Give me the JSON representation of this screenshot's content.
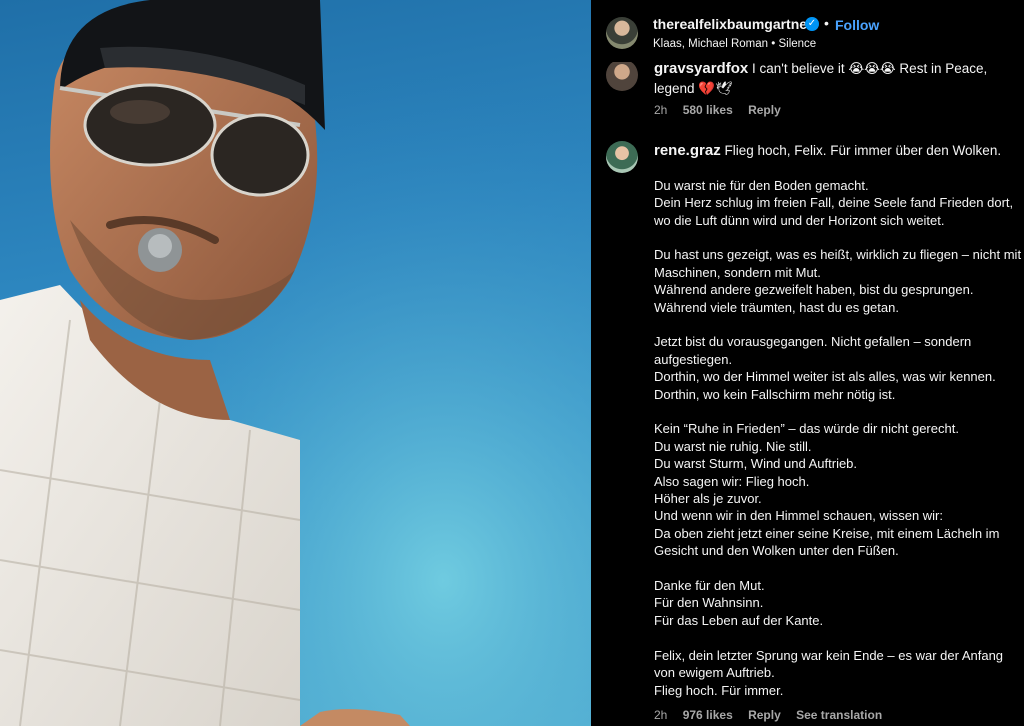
{
  "post": {
    "username": "therealfelixbaumgartner",
    "verified_icon": "verified-badge-icon",
    "separator": "•",
    "follow_label": "Follow",
    "audio": "Klaas, Michael Roman • Silence"
  },
  "comments": [
    {
      "username": "gravsyardfox",
      "text": "I can't believe it 😭😭😭 Rest in Peace, legend 💔🕊",
      "time": "2h",
      "likes": "580 likes",
      "reply": "Reply"
    },
    {
      "username": "rene.graz",
      "first_line": "Flieg hoch, Felix. Für immer über den Wolken.",
      "lines": [
        "",
        "Du warst nie für den Boden gemacht.",
        "Dein Herz schlug im freien Fall, deine Seele fand Frieden dort,",
        "wo die Luft dünn wird und der Horizont sich weitet.",
        "",
        "Du hast uns gezeigt, was es heißt, wirklich zu fliegen – nicht mit",
        "Maschinen, sondern mit Mut.",
        "Während andere gezweifelt haben, bist du gesprungen.",
        "Während viele träumten, hast du es getan.",
        "",
        "Jetzt bist du vorausgegangen. Nicht gefallen – sondern",
        "aufgestiegen.",
        "Dorthin, wo der Himmel weiter ist als alles, was wir kennen.",
        "Dorthin, wo kein Fallschirm mehr nötig ist.",
        "",
        "Kein “Ruhe in Frieden” – das würde dir nicht gerecht.",
        "Du warst nie ruhig. Nie still.",
        "Du warst Sturm, Wind und Auftrieb.",
        "Also sagen wir: Flieg hoch.",
        "Höher als je zuvor.",
        "Und wenn wir in den Himmel schauen, wissen wir:",
        "Da oben zieht jetzt einer seine Kreise, mit einem Lächeln im",
        "Gesicht und den Wolken unter den Füßen.",
        "",
        "Danke für den Mut.",
        "Für den Wahnsinn.",
        "Für das Leben auf der Kante.",
        "",
        "Felix, dein letzter Sprung war kein Ende – es war der Anfang",
        "von ewigem Auftrieb.",
        "Flieg hoch. Für immer."
      ],
      "time": "2h",
      "likes": "976 likes",
      "reply": "Reply",
      "see_translation": "See translation"
    }
  ],
  "colors": {
    "background": "#000000",
    "text": "#f5f5f5",
    "muted": "#a8a8a8",
    "follow": "#4aa3ff",
    "verified": "#0095f6"
  }
}
